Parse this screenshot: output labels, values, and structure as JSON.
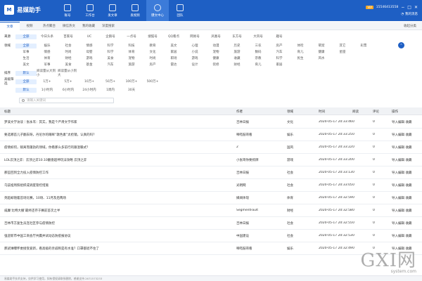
{
  "app": {
    "logo_char": "M",
    "name": "易媒助手",
    "vip": "VIP",
    "phone": "15546413558",
    "messages_label": "我的消息"
  },
  "nav": [
    {
      "label": "账号",
      "icon": "account-icon"
    },
    {
      "label": "工作台",
      "icon": "workbench-icon"
    },
    {
      "label": "发文章",
      "icon": "publish-article-icon"
    },
    {
      "label": "发视频",
      "icon": "publish-video-icon"
    },
    {
      "label": "爆文中心",
      "icon": "viral-center-icon",
      "active": true
    },
    {
      "label": "团队",
      "icon": "team-icon"
    }
  ],
  "tabs": [
    "文章",
    "视频",
    "热点聚合",
    "微信热文",
    "我的收藏",
    "深度搜索"
  ],
  "collapse_label": "收起分类",
  "filters": {
    "source": {
      "label": "来源",
      "options": [
        "全部",
        "今日头条",
        "百家号",
        "UC",
        "企鹅号",
        "一点号",
        "搜狐号",
        "QQ看点",
        "网易号",
        "凤凰号",
        "东方号",
        "大风号",
        "趣号"
      ],
      "selected": 0
    },
    "domain": {
      "label": "领域",
      "row1": [
        "全部",
        "娱乐",
        "社会",
        "情感",
        "科学",
        "科技",
        "教育",
        "美文",
        "心理",
        "动漫",
        "历史",
        "三农",
        "房产",
        "体检",
        "萌宠",
        "其它",
        "彩票"
      ],
      "row2": [
        "军事",
        "情感",
        "时尚",
        "母婴",
        "科学",
        "体育",
        "文化",
        "家居",
        "小说",
        "宠物",
        "旅游",
        "数码",
        "汽车",
        "育儿",
        "健康",
        "星座"
      ],
      "row3": [
        "生活",
        "体育",
        "财经",
        "游戏",
        "美食",
        "宠物",
        "时尚",
        "职场",
        "游戏",
        "健康",
        "收藏",
        "宗教",
        "科学",
        "民生",
        "风水"
      ],
      "row4": [
        "美文",
        "军事",
        "美食",
        "基金",
        "汽车",
        "旅游",
        "房产",
        "雷达",
        "设计",
        "装修",
        "財经",
        "育儿",
        "家居"
      ],
      "selected": 0
    },
    "sort": {
      "label": "排序",
      "options": [
        "默认",
        "阅读量从大到小",
        "阅读量从小到大"
      ],
      "selected": 0
    },
    "advanced": {
      "label": "高级筛选",
      "read_options": [
        "全部",
        "1万+",
        "5万+",
        "10万+",
        "50万+",
        "100万+",
        "500万+"
      ],
      "time_options": [
        "默认",
        "1小时内",
        "6小时内",
        "24小时内",
        "1周内",
        "30天"
      ],
      "read_selected": 0,
      "time_selected": 0
    }
  },
  "search": {
    "placeholder": "请输入关键词"
  },
  "table": {
    "headers": [
      "标题",
      "作者",
      "领域",
      "时间",
      "阅读",
      "评论",
      "操作"
    ],
    "actions": [
      "导入编辑",
      "收藏"
    ],
    "rows": [
      {
        "title": "梦溪文学访谈｜张永苇：其实，我是个严肃文学作家",
        "author": "吉林日报",
        "domain": "文化",
        "time": "2020-05-17 20:33:46",
        "read": "0",
        "comment": "0"
      },
      {
        "title": "要选哪首儿子翻去呀，丹尼尔的眼眸“歌色素”太抢镜，认真的吗？",
        "author": "嘀嗒鼓哥看",
        "domain": "娱乐",
        "time": "2020-05-17 20:33:25",
        "read": "0",
        "comment": "0"
      },
      {
        "title": "疫情如何，赋离而蓬勃的领域，你看那么多前行的跟温暖式？",
        "author": "2",
        "domain": "国风",
        "time": "2020-05-17 20:33:22",
        "read": "0",
        "comment": "0"
      },
      {
        "title": "LOL云顶之弈：云顶之弈10.10翻盘超神玩法攻略 云顶之弈",
        "author": "小张哥你要抓牌",
        "domain": "游戏",
        "time": "2020-05-17 20:33:20",
        "read": "0",
        "comment": "0"
      },
      {
        "title": "那些回到全力投入疫情防控工作",
        "author": "吉林日报",
        "domain": "社会",
        "time": "2020-05-17 20:33:13",
        "read": "0",
        "comment": "0"
      },
      {
        "title": "乌兹娅周照组织成调度管控措施",
        "author": "光明网",
        "domain": "社会",
        "time": "2020-05-17 20:33:05",
        "read": "0",
        "comment": "0"
      },
      {
        "title": "英超却随着首场比赛，10场、11月及后两场",
        "author": "媒闻体现",
        "domain": "体育",
        "time": "2020-05-17 20:32:59",
        "read": "0",
        "comment": "0"
      },
      {
        "title": "威廉‘比特大撤’最终还存于赛前首次之半",
        "author": "SegmentFault",
        "domain": "财经",
        "time": "2020-05-17 20:32:58",
        "read": "0",
        "comment": "0"
      },
      {
        "title": "吉林市方复生员连社区参与疫情防控",
        "author": "吉林日报",
        "domain": "社会",
        "time": "2020-05-17 20:32:55",
        "read": "0",
        "comment": "0"
      },
      {
        "title": "强迎新市中国工商会厅共赢并试动态防疫报协议",
        "author": "中国建设",
        "domain": "社会",
        "time": "2020-05-17 20:32:53",
        "read": "0",
        "comment": "0"
      },
      {
        "title": "郝武琳曝怀委接受爱新，看高级的亲戚称是有水准？口罩都遮不住了",
        "author": "嘀嗒鼓哥看",
        "domain": "娱乐",
        "time": "2020-05-17 20:32:49",
        "read": "0",
        "comment": "0"
      }
    ]
  },
  "footer": "易媒助手技术支持，仅供学习使用，如有侵权请联系删除，感谢支持 2671573233",
  "watermark": {
    "big": "GXI网",
    "small": "system.com"
  }
}
